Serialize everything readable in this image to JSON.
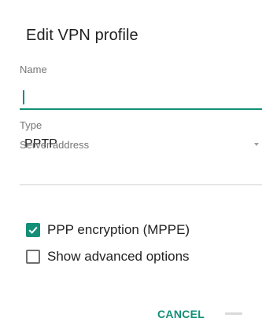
{
  "dialog": {
    "title": "Edit VPN profile",
    "name_field": {
      "label": "Name",
      "value": ""
    },
    "type_field": {
      "label": "Type",
      "value": "PPTP"
    },
    "server_field": {
      "label": "Server address",
      "value": ""
    },
    "options": [
      {
        "label": "PPP encryption (MPPE)",
        "checked": true
      },
      {
        "label": "Show advanced options",
        "checked": false
      }
    ],
    "buttons": {
      "cancel": "CANCEL"
    }
  },
  "colors": {
    "accent": "#138f77",
    "secondary_text": "#757575",
    "primary_text": "#212121"
  },
  "icons": {
    "type_dropdown": "chevron-down-icon",
    "checkbox_checked": "check-icon"
  }
}
